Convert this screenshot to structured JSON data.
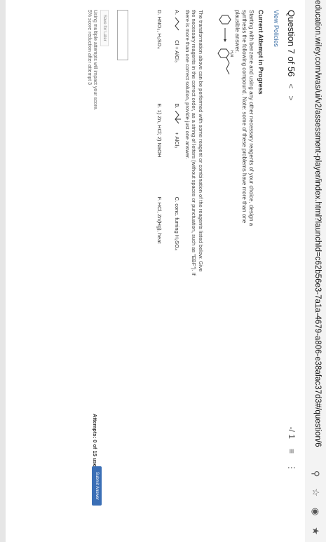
{
  "browser": {
    "url": "education.wiley.com/was/ui/v2/assessment-player/index.html?launchId=c62b56e3-7a1a-4679-a806-e38afac37d3#/question/6"
  },
  "header": {
    "question_label": "Question 7 of 56",
    "score": "-/ 1",
    "list_icon": "≡",
    "more_icon": "⋮"
  },
  "links": {
    "view_policies": "View Policies"
  },
  "section": {
    "title": "Current Attempt in Progress"
  },
  "prompt": {
    "text": "Starting with benzene and using any other necessary reagents of your choice, design a synthesis the following compound. Note: some of these problems have more than one plausible answer."
  },
  "scheme": {
    "label": "H₂N"
  },
  "prompt2": {
    "text": "The transformation above can be performed with some reagent or combination of the reagents listed below. Give the necessary reagents in the correct order, as a string of letters (without spaces or punctuation, such as \"EBF\"). If there is more than one correct solution, provide just one answer."
  },
  "reagents": {
    "A": "A.",
    "A_text": "Cl + AlCl₃",
    "B": "B.",
    "B_text": "+ AlCl₃",
    "C": "C. conc. fuming H₂SO₄",
    "D": "D. HNO₃, H₂SO₄",
    "E": "E. 1) Zn, HCl; 2) NaOH",
    "F": "F. HCl, Zn(Hg), heat"
  },
  "actions": {
    "save_later": "Save for Later",
    "note1": "Using multiple attempts will impact your score.",
    "note2": "5% score reduction after attempt 3",
    "attempts": "Attempts: 0 of 15 used",
    "submit": "Submit Answer"
  }
}
